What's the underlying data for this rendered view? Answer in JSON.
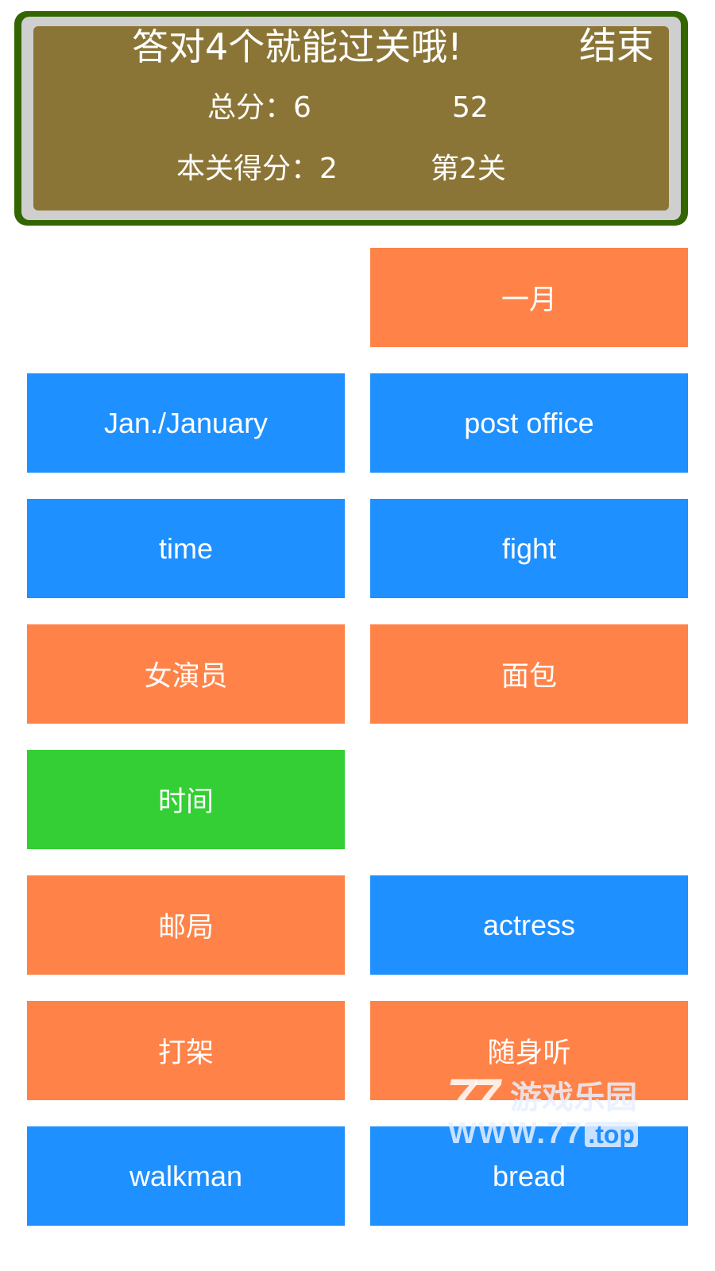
{
  "header": {
    "title": "答对4个就能过关哦!",
    "end_button": "结束",
    "total_score": "总分：6",
    "timer": "52",
    "level_score": "本关得分：2",
    "level": "第2关"
  },
  "colors": {
    "panel_border": "#336600",
    "panel_ring": "#cfcfcf",
    "panel_fill": "#8b7536",
    "tile_blue": "#1f90ff",
    "tile_orange": "#ff8348",
    "tile_green": "#33cf34",
    "text": "#ffffff"
  },
  "tiles": [
    {
      "label": "",
      "state": "empty",
      "lang": "en"
    },
    {
      "label": "一月",
      "state": "orange",
      "lang": "zh"
    },
    {
      "label": "Jan./January",
      "state": "blue",
      "lang": "en"
    },
    {
      "label": "post office",
      "state": "blue",
      "lang": "en"
    },
    {
      "label": "time",
      "state": "blue",
      "lang": "en"
    },
    {
      "label": "fight",
      "state": "blue",
      "lang": "en"
    },
    {
      "label": "女演员",
      "state": "orange",
      "lang": "zh"
    },
    {
      "label": "面包",
      "state": "orange",
      "lang": "zh"
    },
    {
      "label": "时间",
      "state": "green",
      "lang": "zh"
    },
    {
      "label": "",
      "state": "empty",
      "lang": "en"
    },
    {
      "label": "邮局",
      "state": "orange",
      "lang": "zh"
    },
    {
      "label": "actress",
      "state": "blue",
      "lang": "en"
    },
    {
      "label": "打架",
      "state": "orange",
      "lang": "zh"
    },
    {
      "label": "随身听",
      "state": "orange",
      "lang": "zh"
    },
    {
      "label": "walkman",
      "state": "blue",
      "lang": "en"
    },
    {
      "label": "bread",
      "state": "blue",
      "lang": "en"
    }
  ],
  "watermark": {
    "logo": "77",
    "name": "游戏乐园",
    "url_prefix": "WWW.77",
    "url_suffix": ".top"
  }
}
